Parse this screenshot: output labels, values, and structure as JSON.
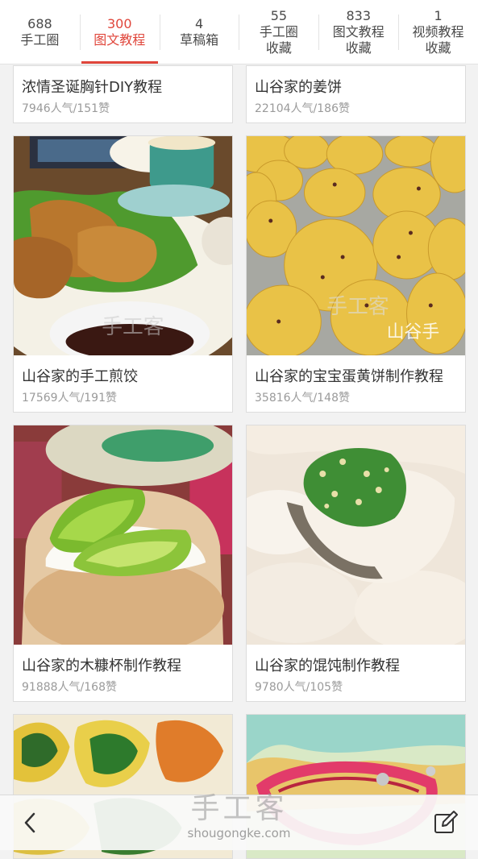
{
  "tabs": [
    {
      "count": "688",
      "label": "手工圈",
      "active": false
    },
    {
      "count": "300",
      "label": "图文教程",
      "active": true
    },
    {
      "count": "4",
      "label": "草稿箱",
      "active": false
    },
    {
      "count": "55",
      "label": "手工圈",
      "label2": "收藏",
      "active": false
    },
    {
      "count": "833",
      "label": "图文教程",
      "label2": "收藏",
      "active": false
    },
    {
      "count": "1",
      "label": "视频教程",
      "label2": "收藏",
      "active": false
    }
  ],
  "cards": [
    {
      "title": "浓情圣诞胸针DIY教程",
      "meta": "7946人气/151赞"
    },
    {
      "title": "山谷家的姜饼",
      "meta": "22104人气/186赞"
    },
    {
      "title": "山谷家的手工煎饺",
      "meta": "17569人气/191赞"
    },
    {
      "title": "山谷家的宝宝蛋黄饼制作教程",
      "meta": "35816人气/148赞"
    },
    {
      "title": "山谷家的木糠杯制作教程",
      "meta": "91888人气/168赞"
    },
    {
      "title": "山谷家的馄饨制作教程",
      "meta": "9780人气/105赞"
    }
  ],
  "bottom": {
    "watermark_main": "手工客",
    "watermark_sub": "shougongke.com"
  },
  "colors": {
    "accent": "#e0463b"
  }
}
